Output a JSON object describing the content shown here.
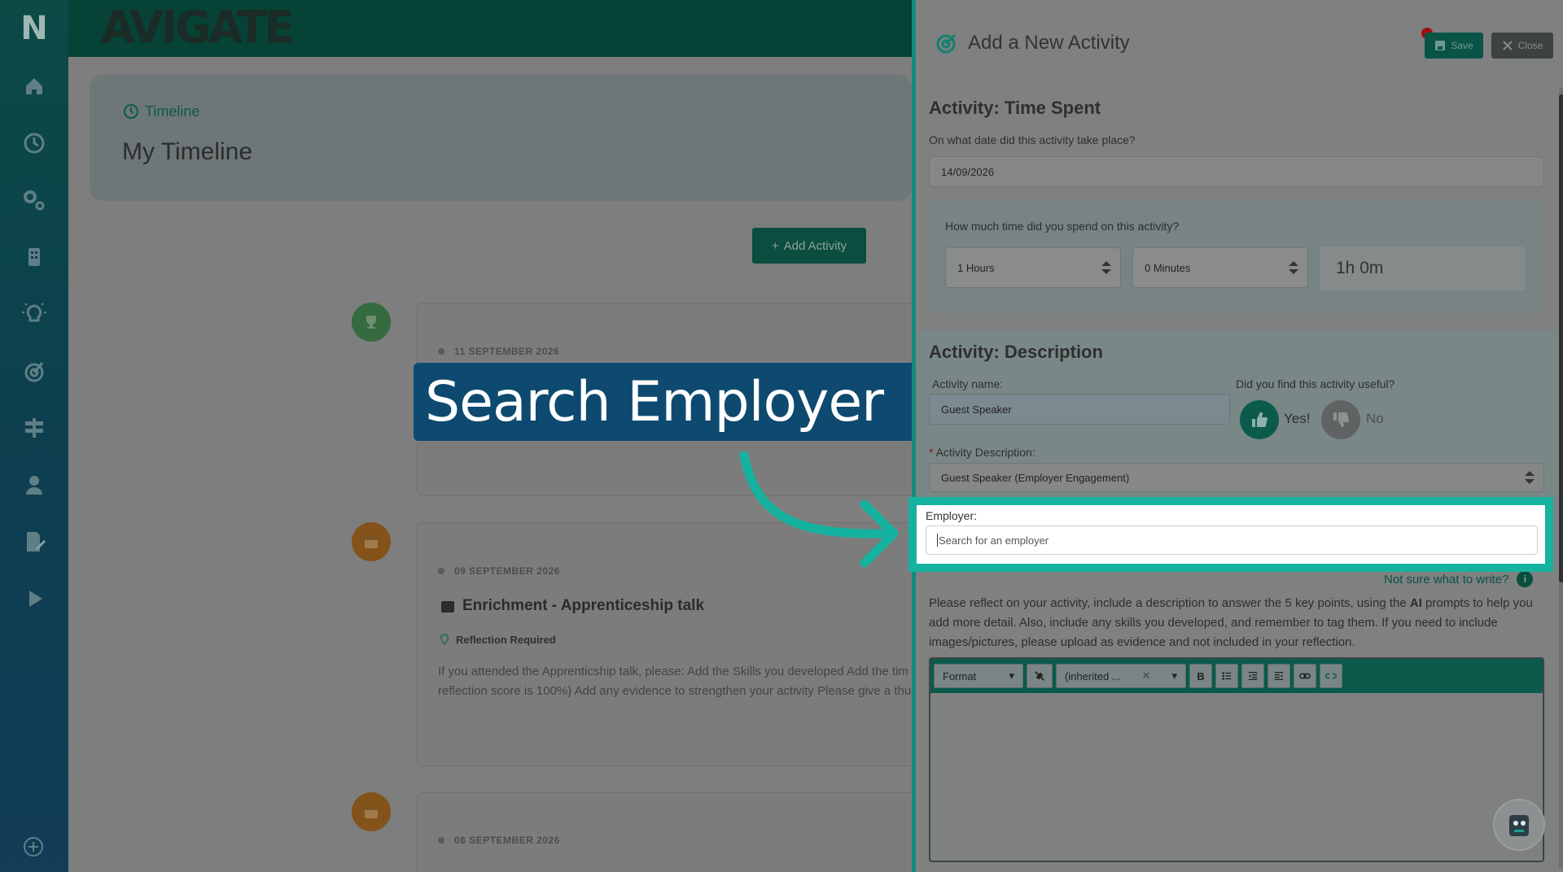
{
  "sidebar": {
    "logo": "N",
    "icons": [
      "home-icon",
      "clock-icon",
      "gears-icon",
      "building-icon",
      "lightbulb-icon",
      "target-icon",
      "signpost-icon",
      "user-icon",
      "edit-file-icon",
      "play-icon"
    ],
    "bottom": "plus-circle-icon"
  },
  "page": {
    "brand": "AVIGATE",
    "breadcrumb": "Timeline",
    "title": "My Timeline",
    "add_activity": "Add Activity",
    "cards": [
      {
        "date": "11 SEPTEMBER 2026"
      },
      {
        "date": "09 SEPTEMBER 2026",
        "title": "Enrichment - Apprenticeship talk",
        "tag": "Reflection Required",
        "text_line1": "If you attended the Apprenticship talk, please: Add the Skills you developed Add the tim",
        "text_line2": "reflection score is 100%) Add any evidence to strengthen your activity Please give a thu"
      },
      {
        "date": "08 SEPTEMBER 2026"
      }
    ]
  },
  "callout": {
    "text": "Search Employer"
  },
  "drawer": {
    "title": "Add a New Activity",
    "save": "Save",
    "close": "Close",
    "time_section": {
      "heading": "Activity: Time Spent",
      "date_label": "On what date did this activity take place?",
      "date_value": "14/09/2026",
      "time_label": "How much time did you spend on this activity?",
      "hours": "1 Hours",
      "minutes": "0 Minutes",
      "total": "1h 0m"
    },
    "desc_section": {
      "heading": "Activity: Description",
      "name_label": "Activity name:",
      "name_value": "Guest Speaker",
      "useful_label": "Did you find this activity useful?",
      "yes": "Yes!",
      "no": "No",
      "desc_label": "Activity Description:",
      "desc_value": "Guest Speaker (Employer Engagement)",
      "employer_label": "Employer:",
      "employer_placeholder": "Search for an employer",
      "help": "Not sure what to write?",
      "instructions_pre": "Please reflect on your activity, include a description to answer the 5 key points, using the ",
      "instructions_bold": "AI",
      "instructions_post": " prompts to help you add more detail. Also, include any skills you developed, and remember to tag them. If you need to include images/pictures, please upload as evidence and not included in your reflection."
    },
    "editor": {
      "format": "Format",
      "font": "(inherited ...",
      "bold": "B"
    }
  },
  "colors": {
    "accent": "#15b39f",
    "brand_dark": "#0b4d3f",
    "callout": "#0e4a70"
  }
}
